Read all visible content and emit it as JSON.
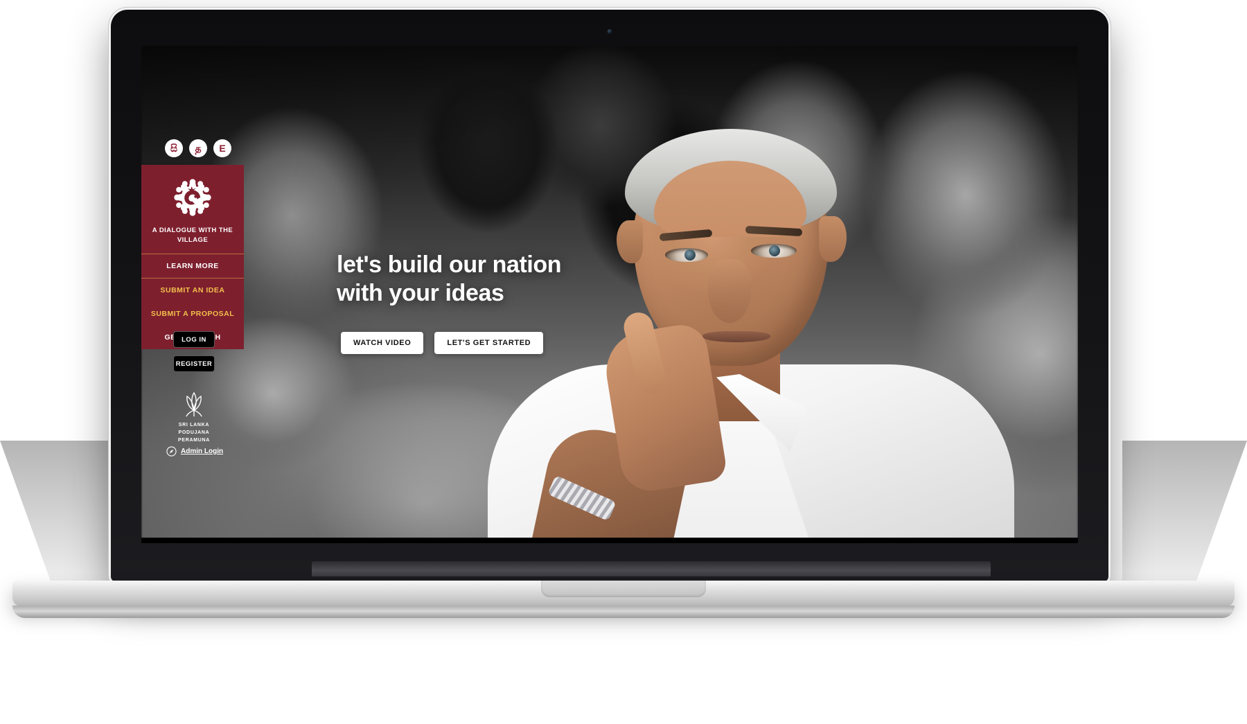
{
  "device": {
    "type": "laptop-mockup",
    "webcam": "webcam-dot"
  },
  "site": {
    "lang_switch": [
      {
        "id": "sinhala",
        "label": "සි"
      },
      {
        "id": "tamil",
        "label": "த"
      },
      {
        "id": "english",
        "label": "E"
      }
    ],
    "sidebar": {
      "logo_icon": "lotus-emblem-icon",
      "title": "A DIALOGUE WITH THE VILLAGE",
      "links": [
        {
          "label": "LEARN MORE",
          "style": "white"
        },
        {
          "label": "SUBMIT AN IDEA",
          "style": "gold"
        },
        {
          "label": "SUBMIT A PROPOSAL",
          "style": "gold"
        },
        {
          "label": "GET IN TOUCH",
          "style": "white"
        }
      ]
    },
    "auth": {
      "login_label": "LOG IN",
      "register_label": "REGISTER"
    },
    "party": {
      "mark_icon": "lotus-bud-icon",
      "name_line1": "SRI LANKA",
      "name_line2": "PODUJANA",
      "name_line3": "PERAMUNA"
    },
    "admin": {
      "icon": "compass-icon",
      "label": "Admin Login"
    },
    "hero": {
      "headline_line1": "let's build our nation",
      "headline_line2": "with your ideas",
      "cta": [
        {
          "label": "WATCH VIDEO"
        },
        {
          "label": "LET'S GET STARTED"
        }
      ]
    }
  },
  "colors": {
    "brand_maroon": "#7e1f2e",
    "brand_gold": "#f2c14b",
    "divider_gold": "#b4743a",
    "button_black": "#000000",
    "button_white": "#ffffff",
    "accent_pink": "#ff4d63"
  }
}
